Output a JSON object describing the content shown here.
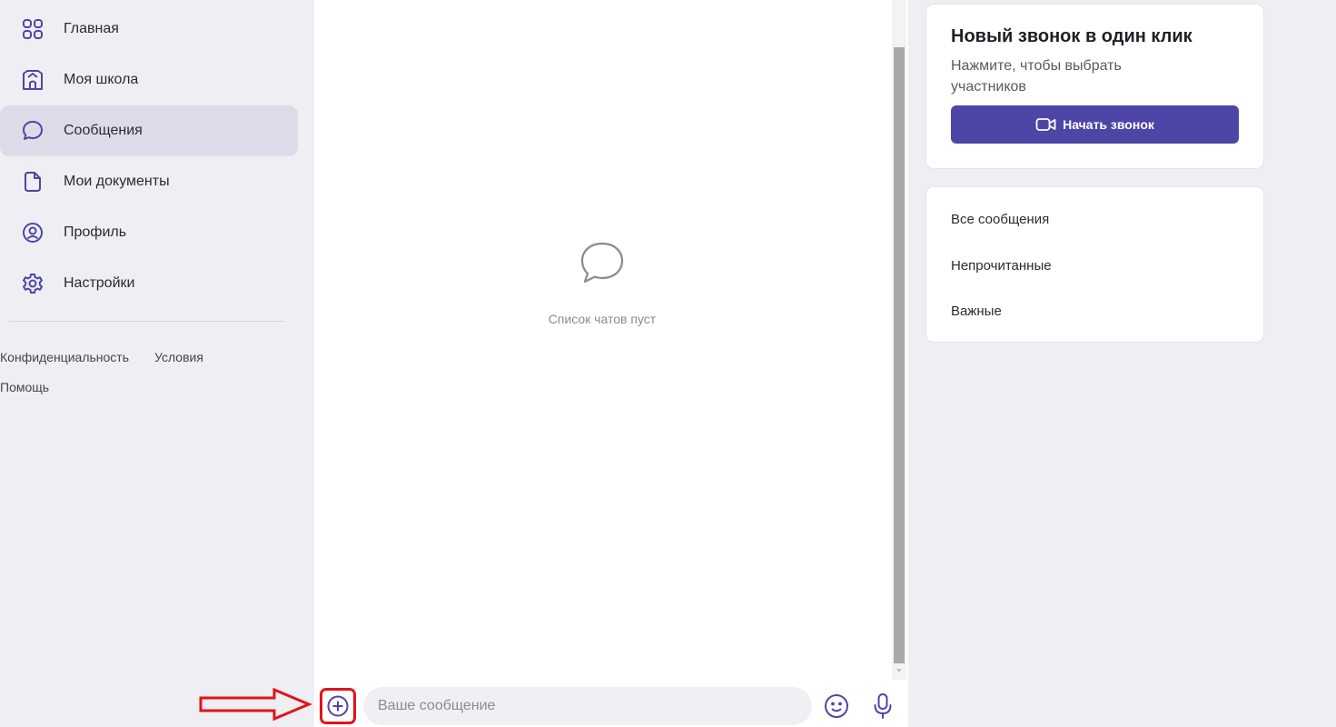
{
  "sidebar": {
    "items": [
      {
        "label": "Главная",
        "icon": "grid-icon",
        "active": false
      },
      {
        "label": "Моя школа",
        "icon": "school-icon",
        "active": false
      },
      {
        "label": "Сообщения",
        "icon": "chat-bubble-icon",
        "active": true
      },
      {
        "label": "Мои документы",
        "icon": "document-icon",
        "active": false
      },
      {
        "label": "Профиль",
        "icon": "user-circle-icon",
        "active": false
      },
      {
        "label": "Настройки",
        "icon": "gear-icon",
        "active": false
      }
    ],
    "footer": {
      "privacy": "Конфиденциальность",
      "terms": "Условия",
      "help": "Помощь"
    }
  },
  "chat": {
    "empty_text": "Список чатов пуст",
    "composer": {
      "placeholder": "Ваше сообщение"
    }
  },
  "call_card": {
    "title": "Новый звонок в один клик",
    "subtitle": "Нажмите, чтобы выбрать участников",
    "button_label": "Начать звонок"
  },
  "filters": [
    {
      "label": "Все сообщения"
    },
    {
      "label": "Непрочитанные"
    },
    {
      "label": "Важные"
    }
  ],
  "colors": {
    "accent": "#4d46a6",
    "icon": "#4d46a6",
    "annotation": "#e3121b",
    "sidebar_bg": "#eeeef3",
    "active_item_bg": "#dcdce9"
  }
}
